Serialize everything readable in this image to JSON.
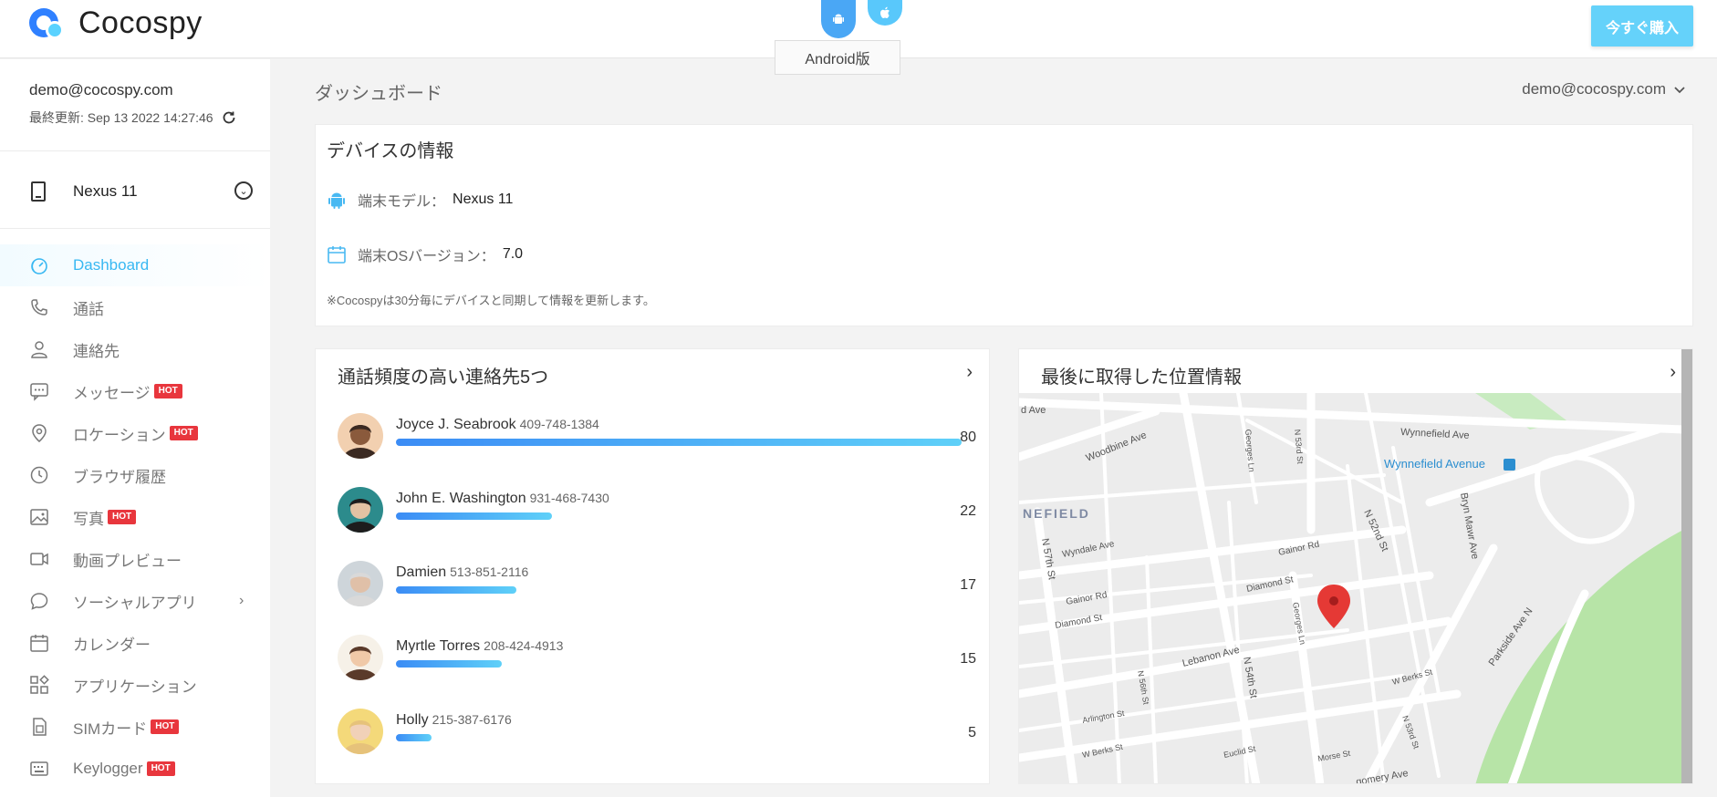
{
  "brand": {
    "name": "Cocospy",
    "buy_label": "今すぐ購入"
  },
  "os_switch": {
    "tooltip": "Android版",
    "options": [
      "android-icon",
      "apple-icon"
    ]
  },
  "account": {
    "email": "demo@cocospy.com",
    "last_updated": "最終更新: Sep 13 2022 14:27:46"
  },
  "device": {
    "name": "Nexus 11"
  },
  "sidebar": {
    "items": [
      {
        "label": "Dashboard",
        "icon": "gauge-icon",
        "hot": false,
        "active": true
      },
      {
        "label": "通話",
        "icon": "phone-icon",
        "hot": false
      },
      {
        "label": "連絡先",
        "icon": "person-icon",
        "hot": false
      },
      {
        "label": "メッセージ",
        "icon": "chat-icon",
        "hot": true
      },
      {
        "label": "ロケーション",
        "icon": "location-pin-icon",
        "hot": true
      },
      {
        "label": "ブラウザ履歴",
        "icon": "clock-icon",
        "hot": false
      },
      {
        "label": "写真",
        "icon": "image-icon",
        "hot": true
      },
      {
        "label": "動画プレビュー",
        "icon": "video-icon",
        "hot": false
      },
      {
        "label": "ソーシャルアプリ",
        "icon": "speech-bubble-icon",
        "hot": false,
        "has_chevron": true
      },
      {
        "label": "カレンダー",
        "icon": "calendar-icon",
        "hot": false
      },
      {
        "label": "アプリケーション",
        "icon": "apps-grid-icon",
        "hot": false
      },
      {
        "label": "SIMカード",
        "icon": "sim-card-icon",
        "hot": true
      },
      {
        "label": "Keylogger",
        "icon": "keyboard-icon",
        "hot": true
      }
    ],
    "hot_label": "HOT"
  },
  "header": {
    "breadcrumb": "ダッシュボード",
    "user_email": "demo@cocospy.com"
  },
  "device_info": {
    "title": "デバイスの情報",
    "model_label": "端末モデル：",
    "model_value": "Nexus 11",
    "os_label": "端末OSバージョン：",
    "os_value": "7.0",
    "note": "※Cocospyは30分毎にデバイスと同期して情報を更新します。"
  },
  "top_contacts": {
    "title": "通話頻度の高い連絡先5つ",
    "max": 80,
    "items": [
      {
        "name": "Joyce J. Seabrook",
        "phone": "409-748-1384",
        "count": 80
      },
      {
        "name": "John E. Washington",
        "phone": "931-468-7430",
        "count": 22
      },
      {
        "name": "Damien",
        "phone": "513-851-2116",
        "count": 17
      },
      {
        "name": "Myrtle Torres",
        "phone": "208-424-4913",
        "count": 15
      },
      {
        "name": "Holly",
        "phone": "215-387-6176",
        "count": 5
      }
    ]
  },
  "last_location": {
    "title": "最後に取得した位置情報",
    "map_labels": {
      "wynnefield_ave": "Wynnefield Ave",
      "wynnefield_avenue_stop": "Wynnefield Avenue",
      "woodbine_ave": "Woodbine Ave",
      "d_ave": "d Ave",
      "nefield": "NEFIELD",
      "georges_ln_1": "Georges Ln",
      "n53rd_1": "N 53rd St",
      "n52nd": "N 52nd St",
      "bryn_mawr": "Bryn Mawr Ave",
      "wyndale": "Wyndale Ave",
      "gainor_1": "Gainor Rd",
      "gainor_2": "Gainor Rd",
      "n57th": "N 57th St",
      "diamond_1": "Diamond St",
      "diamond_2": "Diamond St",
      "lebanon": "Lebanon Ave",
      "n54th": "N 54th St",
      "georges_ln_2": "Georges Ln",
      "parkside": "Parkside Ave N",
      "w_berks_1": "W Berks St",
      "w_berks_2": "W Berks St",
      "n56th": "N 56th St",
      "arlington": "Arlington St",
      "n53rd_2": "N 53rd St",
      "euclid": "Euclid St",
      "morse": "Morse St",
      "montgomery": "gomery Ave"
    }
  }
}
